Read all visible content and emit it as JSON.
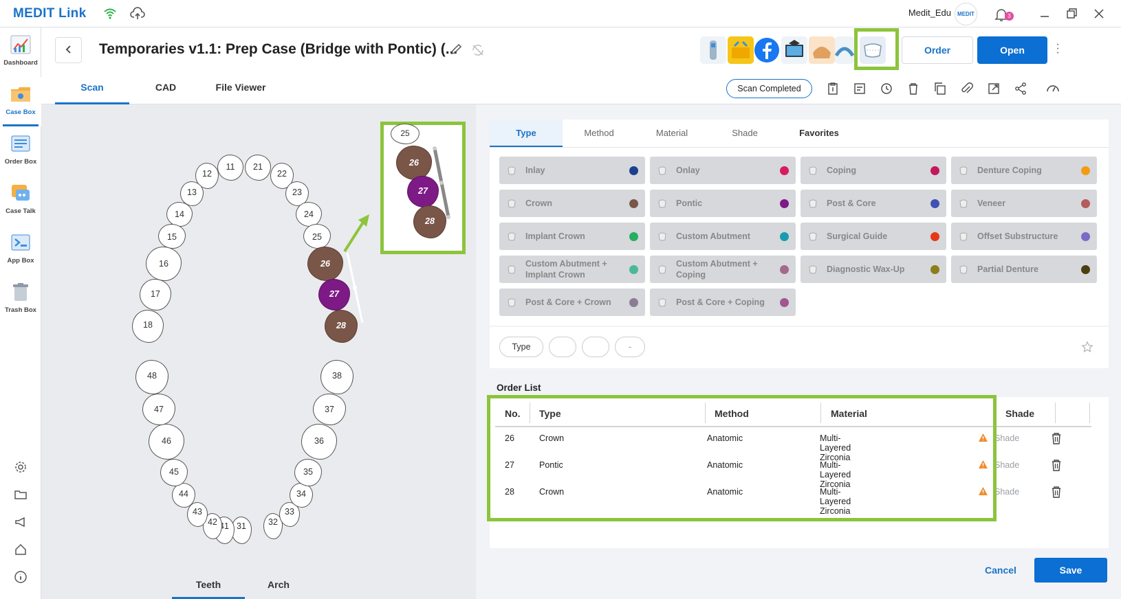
{
  "titlebar": {
    "logo": "MEDIT Link",
    "user": "Medit_Edu",
    "avatar_text": "MEDIT",
    "notifications": "3"
  },
  "sidebar": {
    "items": [
      {
        "label": "Dashboard"
      },
      {
        "label": "Case Box"
      },
      {
        "label": "Order Box"
      },
      {
        "label": "Case Talk"
      },
      {
        "label": "App Box"
      },
      {
        "label": "Trash Box"
      }
    ]
  },
  "header": {
    "title": "Temporaries v1.1: Prep Case (Bridge with Pontic) (...",
    "order_label": "Order",
    "open_label": "Open",
    "tabs": [
      "Scan",
      "CAD",
      "File Viewer"
    ],
    "status": "Scan Completed"
  },
  "teeth": {
    "upper": [
      "11",
      "12",
      "13",
      "14",
      "15",
      "16",
      "17",
      "18",
      "21",
      "22",
      "23",
      "24",
      "25",
      "26",
      "27",
      "28"
    ],
    "lower": [
      "31",
      "32",
      "33",
      "34",
      "35",
      "36",
      "37",
      "38",
      "41",
      "42",
      "43",
      "44",
      "45",
      "46",
      "47",
      "48"
    ],
    "zoom": [
      "25",
      "26",
      "27",
      "28"
    ],
    "bottom_tabs": [
      "Teeth",
      "Arch"
    ]
  },
  "type_panel": {
    "tabs": [
      "Type",
      "Method",
      "Material",
      "Shade",
      "Favorites"
    ],
    "cards": [
      {
        "label": "Inlay",
        "color": "#1c3f8f"
      },
      {
        "label": "Onlay",
        "color": "#d81b60"
      },
      {
        "label": "Coping",
        "color": "#c2185b"
      },
      {
        "label": "Denture Coping",
        "color": "#f39c12"
      },
      {
        "label": "Crown",
        "color": "#7a5648"
      },
      {
        "label": "Pontic",
        "color": "#7d1a86"
      },
      {
        "label": "Post & Core",
        "color": "#3f51b5"
      },
      {
        "label": "Veneer",
        "color": "#b55b5b"
      },
      {
        "label": "Implant Crown",
        "color": "#27ae60"
      },
      {
        "label": "Custom Abutment",
        "color": "#1a9bb0"
      },
      {
        "label": "Surgical Guide",
        "color": "#e53917"
      },
      {
        "label": "Offset Substructure",
        "color": "#7c6bc4"
      },
      {
        "label": "Custom Abutment + Implant Crown",
        "color": "#4bb89a"
      },
      {
        "label": "Custom Abutment + Coping",
        "color": "#a56a8a"
      },
      {
        "label": "Diagnostic Wax-Up",
        "color": "#8e7d1c"
      },
      {
        "label": "Partial Denture",
        "color": "#4a3f10"
      },
      {
        "label": "Post & Core + Crown",
        "color": "#8c7b95"
      },
      {
        "label": "Post & Core + Coping",
        "color": "#a0578f"
      }
    ],
    "chips": [
      "Type",
      "",
      "",
      "-"
    ]
  },
  "order_list": {
    "title": "Order List",
    "columns": [
      "No.",
      "Type",
      "Method",
      "Material",
      "Shade"
    ],
    "rows": [
      {
        "no": "26",
        "type": "Crown",
        "method": "Anatomic",
        "material": "Multi-Layered Zirconia",
        "shade": "Shade"
      },
      {
        "no": "27",
        "type": "Pontic",
        "method": "Anatomic",
        "material": "Multi-Layered Zirconia",
        "shade": "Shade"
      },
      {
        "no": "28",
        "type": "Crown",
        "method": "Anatomic",
        "material": "Multi-Layered Zirconia",
        "shade": "Shade"
      }
    ]
  },
  "footer": {
    "cancel_label": "Cancel",
    "save_label": "Save"
  }
}
